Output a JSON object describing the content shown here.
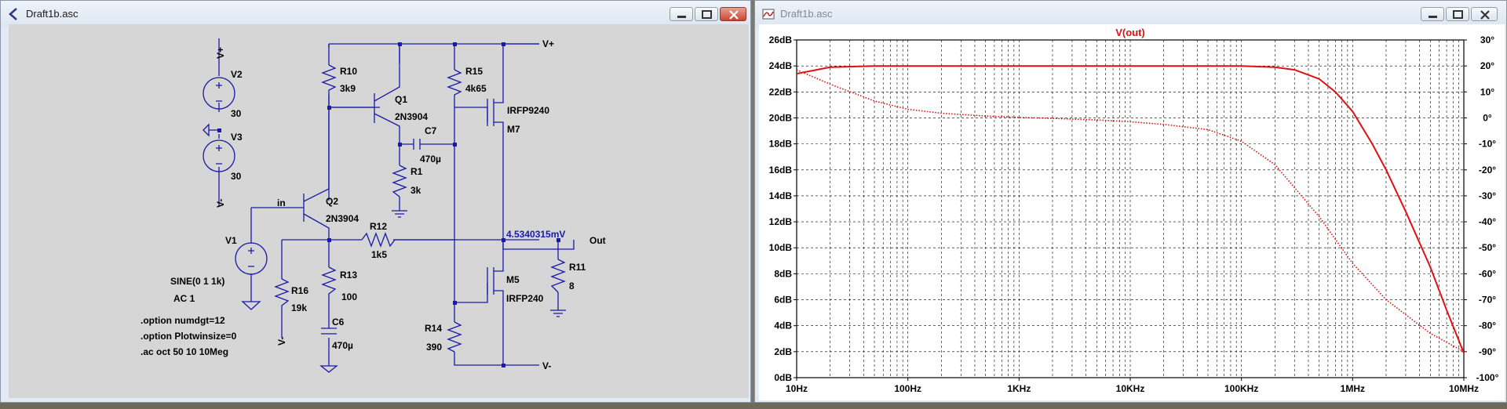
{
  "schematic_window": {
    "title": "Draft1b.asc",
    "labels": {
      "vplus_top": "V+",
      "v2": "V2",
      "v2_value": "30",
      "v3": "V3",
      "v3_value": "30",
      "vminus_left": "V-",
      "r10": "R10",
      "r10_value": "3k9",
      "q1": "Q1",
      "q1_model": "2N3904",
      "r15": "R15",
      "r15_value": "4k65",
      "m7_model": "IRFP9240",
      "m7": "M7",
      "c7": "C7",
      "c7_value": "470µ",
      "r1": "R1",
      "r1_value": "3k",
      "in": "in",
      "q2": "Q2",
      "q2_model": "2N3904",
      "v1": "V1",
      "r12": "R12",
      "r12_value": "1k5",
      "node_voltage": "4.5340315mV",
      "out": "Out",
      "r11": "R11",
      "r11_value": "8",
      "r13": "R13",
      "r13_value": "100",
      "r16": "R16",
      "r16_value": "19k",
      "v1_value": "SINE(0 1 1k)",
      "v1_ac": "AC 1",
      "c6": "C6",
      "c6_value": "470µ",
      "m5": "M5",
      "m5_model": "IRFP240",
      "r14": "R14",
      "r14_value": "390",
      "vminus_bottom": "V-",
      "vminus_r16": "V-",
      "directive_1": ".option numdgt=12",
      "directive_2": ".option Plotwinsize=0",
      "directive_3": ".ac oct 50 10 10Meg"
    },
    "colors": {
      "wire": "#1a1aa8",
      "text": "#000000",
      "node_label": "#1a1aa8"
    }
  },
  "plot_window": {
    "title": "Draft1b.asc",
    "colors": {
      "trace": "#e01010",
      "grid": "#000000",
      "background": "#ffffff"
    },
    "chart_data": {
      "type": "line",
      "title": "V(out)",
      "x_scale": "log",
      "xlim": [
        10,
        10000000
      ],
      "x_ticks": [
        "10Hz",
        "100Hz",
        "1KHz",
        "10KHz",
        "100KHz",
        "1MHz",
        "10MHz"
      ],
      "y_left_ticks": [
        "0dB",
        "2dB",
        "4dB",
        "6dB",
        "8dB",
        "10dB",
        "12dB",
        "14dB",
        "16dB",
        "18dB",
        "20dB",
        "22dB",
        "24dB",
        "26dB"
      ],
      "y_right_ticks": [
        "30°",
        "20°",
        "10°",
        "0°",
        "-10°",
        "-20°",
        "-30°",
        "-40°",
        "-50°",
        "-60°",
        "-70°",
        "-80°",
        "-90°",
        "-100°"
      ],
      "ylim_left": [
        0,
        26
      ],
      "ylim_right": [
        -100,
        30
      ],
      "grid": true,
      "series": [
        {
          "style": "solid",
          "axis": "left",
          "x": [
            10,
            20,
            50,
            100,
            1000,
            10000,
            100000,
            200000,
            300000,
            500000,
            700000,
            1000000,
            1500000,
            2000000,
            3000000,
            5000000,
            7000000,
            10000000
          ],
          "y": [
            23.4,
            23.9,
            24.0,
            24.0,
            24.0,
            24.0,
            24.0,
            23.9,
            23.7,
            23.0,
            22.0,
            20.5,
            18.0,
            16.0,
            12.8,
            8.5,
            5.2,
            1.9
          ]
        },
        {
          "style": "dotted",
          "axis": "right",
          "x": [
            10,
            20,
            50,
            100,
            200,
            500,
            1000,
            2000,
            5000,
            10000,
            20000,
            50000,
            100000,
            200000,
            500000,
            1000000,
            2000000,
            5000000,
            10000000
          ],
          "y": [
            18.5,
            13,
            6.5,
            3.3,
            1.8,
            0.7,
            0.2,
            -0.2,
            -0.8,
            -1.5,
            -2.5,
            -4.5,
            -9,
            -18,
            -38,
            -56,
            -70,
            -83,
            -90
          ]
        }
      ]
    }
  }
}
